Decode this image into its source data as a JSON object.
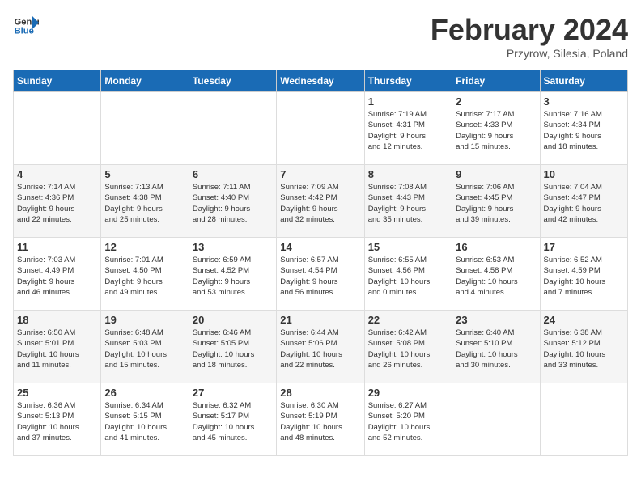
{
  "header": {
    "logo_line1": "General",
    "logo_line2": "Blue",
    "month": "February 2024",
    "location": "Przyrow, Silesia, Poland"
  },
  "weekdays": [
    "Sunday",
    "Monday",
    "Tuesday",
    "Wednesday",
    "Thursday",
    "Friday",
    "Saturday"
  ],
  "weeks": [
    [
      {
        "day": "",
        "info": ""
      },
      {
        "day": "",
        "info": ""
      },
      {
        "day": "",
        "info": ""
      },
      {
        "day": "",
        "info": ""
      },
      {
        "day": "1",
        "info": "Sunrise: 7:19 AM\nSunset: 4:31 PM\nDaylight: 9 hours\nand 12 minutes."
      },
      {
        "day": "2",
        "info": "Sunrise: 7:17 AM\nSunset: 4:33 PM\nDaylight: 9 hours\nand 15 minutes."
      },
      {
        "day": "3",
        "info": "Sunrise: 7:16 AM\nSunset: 4:34 PM\nDaylight: 9 hours\nand 18 minutes."
      }
    ],
    [
      {
        "day": "4",
        "info": "Sunrise: 7:14 AM\nSunset: 4:36 PM\nDaylight: 9 hours\nand 22 minutes."
      },
      {
        "day": "5",
        "info": "Sunrise: 7:13 AM\nSunset: 4:38 PM\nDaylight: 9 hours\nand 25 minutes."
      },
      {
        "day": "6",
        "info": "Sunrise: 7:11 AM\nSunset: 4:40 PM\nDaylight: 9 hours\nand 28 minutes."
      },
      {
        "day": "7",
        "info": "Sunrise: 7:09 AM\nSunset: 4:42 PM\nDaylight: 9 hours\nand 32 minutes."
      },
      {
        "day": "8",
        "info": "Sunrise: 7:08 AM\nSunset: 4:43 PM\nDaylight: 9 hours\nand 35 minutes."
      },
      {
        "day": "9",
        "info": "Sunrise: 7:06 AM\nSunset: 4:45 PM\nDaylight: 9 hours\nand 39 minutes."
      },
      {
        "day": "10",
        "info": "Sunrise: 7:04 AM\nSunset: 4:47 PM\nDaylight: 9 hours\nand 42 minutes."
      }
    ],
    [
      {
        "day": "11",
        "info": "Sunrise: 7:03 AM\nSunset: 4:49 PM\nDaylight: 9 hours\nand 46 minutes."
      },
      {
        "day": "12",
        "info": "Sunrise: 7:01 AM\nSunset: 4:50 PM\nDaylight: 9 hours\nand 49 minutes."
      },
      {
        "day": "13",
        "info": "Sunrise: 6:59 AM\nSunset: 4:52 PM\nDaylight: 9 hours\nand 53 minutes."
      },
      {
        "day": "14",
        "info": "Sunrise: 6:57 AM\nSunset: 4:54 PM\nDaylight: 9 hours\nand 56 minutes."
      },
      {
        "day": "15",
        "info": "Sunrise: 6:55 AM\nSunset: 4:56 PM\nDaylight: 10 hours\nand 0 minutes."
      },
      {
        "day": "16",
        "info": "Sunrise: 6:53 AM\nSunset: 4:58 PM\nDaylight: 10 hours\nand 4 minutes."
      },
      {
        "day": "17",
        "info": "Sunrise: 6:52 AM\nSunset: 4:59 PM\nDaylight: 10 hours\nand 7 minutes."
      }
    ],
    [
      {
        "day": "18",
        "info": "Sunrise: 6:50 AM\nSunset: 5:01 PM\nDaylight: 10 hours\nand 11 minutes."
      },
      {
        "day": "19",
        "info": "Sunrise: 6:48 AM\nSunset: 5:03 PM\nDaylight: 10 hours\nand 15 minutes."
      },
      {
        "day": "20",
        "info": "Sunrise: 6:46 AM\nSunset: 5:05 PM\nDaylight: 10 hours\nand 18 minutes."
      },
      {
        "day": "21",
        "info": "Sunrise: 6:44 AM\nSunset: 5:06 PM\nDaylight: 10 hours\nand 22 minutes."
      },
      {
        "day": "22",
        "info": "Sunrise: 6:42 AM\nSunset: 5:08 PM\nDaylight: 10 hours\nand 26 minutes."
      },
      {
        "day": "23",
        "info": "Sunrise: 6:40 AM\nSunset: 5:10 PM\nDaylight: 10 hours\nand 30 minutes."
      },
      {
        "day": "24",
        "info": "Sunrise: 6:38 AM\nSunset: 5:12 PM\nDaylight: 10 hours\nand 33 minutes."
      }
    ],
    [
      {
        "day": "25",
        "info": "Sunrise: 6:36 AM\nSunset: 5:13 PM\nDaylight: 10 hours\nand 37 minutes."
      },
      {
        "day": "26",
        "info": "Sunrise: 6:34 AM\nSunset: 5:15 PM\nDaylight: 10 hours\nand 41 minutes."
      },
      {
        "day": "27",
        "info": "Sunrise: 6:32 AM\nSunset: 5:17 PM\nDaylight: 10 hours\nand 45 minutes."
      },
      {
        "day": "28",
        "info": "Sunrise: 6:30 AM\nSunset: 5:19 PM\nDaylight: 10 hours\nand 48 minutes."
      },
      {
        "day": "29",
        "info": "Sunrise: 6:27 AM\nSunset: 5:20 PM\nDaylight: 10 hours\nand 52 minutes."
      },
      {
        "day": "",
        "info": ""
      },
      {
        "day": "",
        "info": ""
      }
    ]
  ]
}
